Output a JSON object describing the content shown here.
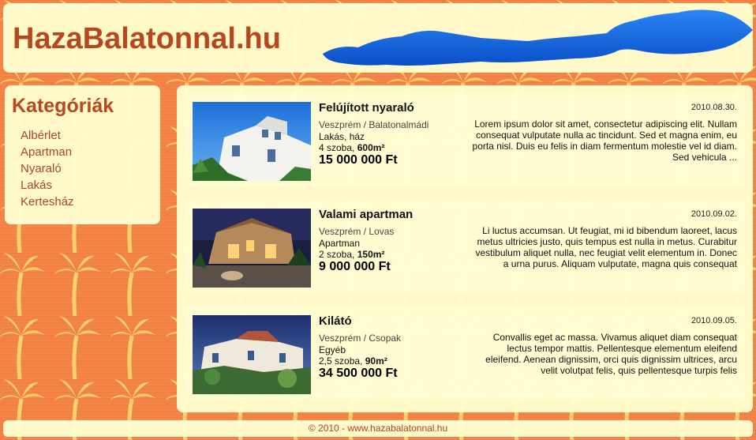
{
  "site": {
    "logo": "HazaBalatonnal.hu"
  },
  "sidebar": {
    "title": "Kategóriák",
    "items": [
      "Albérlet",
      "Apartman",
      "Nyaraló",
      "Lakás",
      "Kertesház"
    ]
  },
  "listings": [
    {
      "title": "Felújított nyaraló",
      "location": "Veszprém / Balatonalmádi",
      "type": "Lakás, ház",
      "rooms": "4 szoba,",
      "area": "600m²",
      "price": "15 000 000 Ft",
      "date": "2010.08.30.",
      "description": "Lorem ipsum dolor sit amet, consectetur adipiscing elit. Nullam consequat vulputate nulla ac tincidunt. Sed et magna enim, eu porta nisl. Duis eu felis in diam fermentum molestie vel id diam. Sed vehicula ..."
    },
    {
      "title": "Valami apartman",
      "location": "Veszprém / Lovas",
      "type": "Apartman",
      "rooms": "2 szoba,",
      "area": "150m²",
      "price": "9 000 000 Ft",
      "date": "2010.09.02.",
      "description": "Li luctus accumsan. Ut feugiat, mi id bibendum laoreet, lacus metus ultricies justo, quis tempus est nulla in metus. Curabitur vestibulum aliquet nulla, nec feugiat velit elementum in. Donec a urna purus. Aliquam vulputate, magna quis consequat"
    },
    {
      "title": "Kilátó",
      "location": "Veszprém / Csopak",
      "type": "Egyéb",
      "rooms": "2,5 szoba,",
      "area": "90m²",
      "price": "34 500 000 Ft",
      "date": "2010.09.05.",
      "description": "Convallis eget ac massa. Vivamus aliquet diam consequat lectus tempor mattis. Pellentesque elementum eleifend eleifend. Aenean dignissim, orci quis dignissim ultrices, arcu velit volutpat felis, quis pellentesque turpis felis"
    }
  ],
  "footer": {
    "text": "© 2010 - www.hazabalatonnal.hu"
  },
  "colors": {
    "accent": "#b8461f",
    "background": "#f5864a",
    "panel": "#fffdcd",
    "lake": "#1464e0"
  }
}
